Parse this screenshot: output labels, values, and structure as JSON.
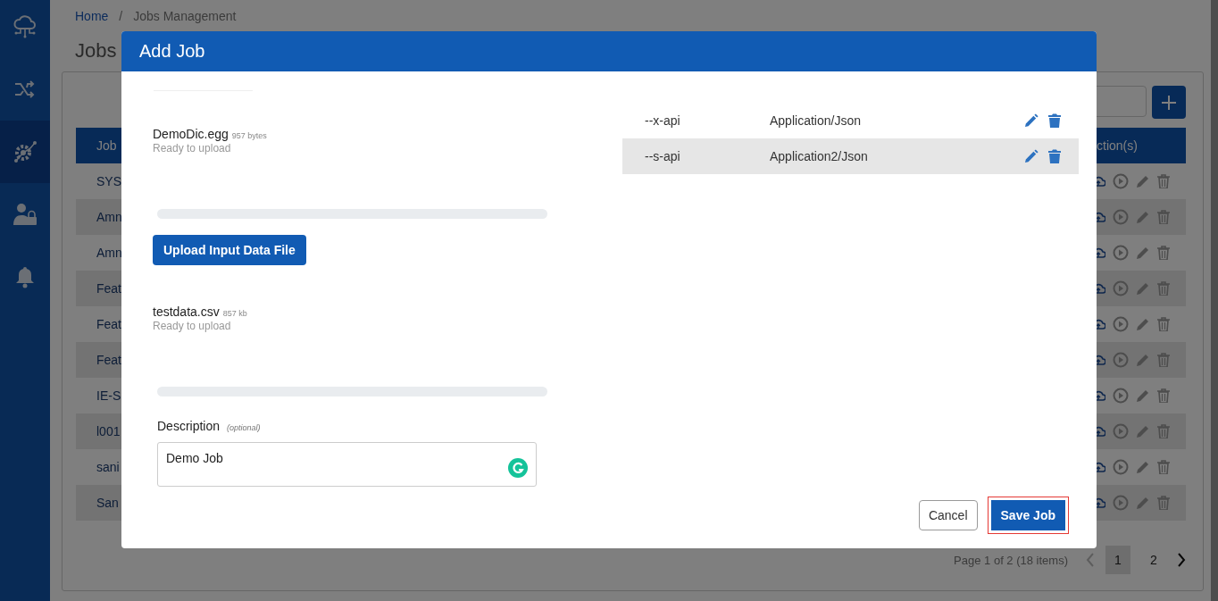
{
  "sidebar": {
    "items": [
      {
        "kind": "cloud",
        "selected": false
      },
      {
        "kind": "shuffle",
        "selected": false
      },
      {
        "kind": "gear",
        "selected": true
      },
      {
        "kind": "user-lock",
        "selected": false
      },
      {
        "kind": "bell",
        "selected": false
      }
    ]
  },
  "breadcrumb_separator": "/",
  "breadcrumb": [
    {
      "label": "Home",
      "kind": "link"
    },
    {
      "label": "Jobs Management",
      "kind": "current"
    }
  ],
  "page_title": "Jobs",
  "table": {
    "columns": [
      "Job",
      "ction(s)"
    ],
    "rows": [
      {
        "name": "SYS"
      },
      {
        "name": "Amn"
      },
      {
        "name": "Amn"
      },
      {
        "name": "Feat"
      },
      {
        "name": "Feat"
      },
      {
        "name": "Feat"
      },
      {
        "name": "IE-S"
      },
      {
        "name": "l001"
      },
      {
        "name": "sani"
      },
      {
        "name": "San"
      }
    ]
  },
  "pagination": {
    "summary": "Page 1 of 2 (18 items)",
    "previous_disabled": true,
    "next_disabled": false,
    "pages": [
      {
        "label": "1",
        "selected": true
      },
      {
        "label": "2",
        "selected": false
      }
    ]
  },
  "dialog": {
    "title": "Add Job",
    "left": [
      {
        "kind": "file",
        "name": "DemoDic.egg",
        "size": "957 bytes",
        "status": "Ready to upload"
      },
      {
        "kind": "progress"
      },
      {
        "kind": "button",
        "label": "Upload Input Data File"
      },
      {
        "kind": "file",
        "name": "testdata.csv",
        "size": "857 kb",
        "status": "Ready to upload"
      },
      {
        "kind": "progress"
      }
    ],
    "description": {
      "label": "Description",
      "hint": "(optional)",
      "value": "Demo Job"
    },
    "headers": [
      {
        "name": "--x-api",
        "value": "Application/Json",
        "selected": false
      },
      {
        "name": "--s-api",
        "value": "Application2/Json",
        "selected": true
      }
    ],
    "buttons": [
      {
        "label": "Cancel",
        "kind": "secondary",
        "focused": false
      },
      {
        "label": "Save Job",
        "kind": "primary",
        "focused": true
      }
    ]
  }
}
